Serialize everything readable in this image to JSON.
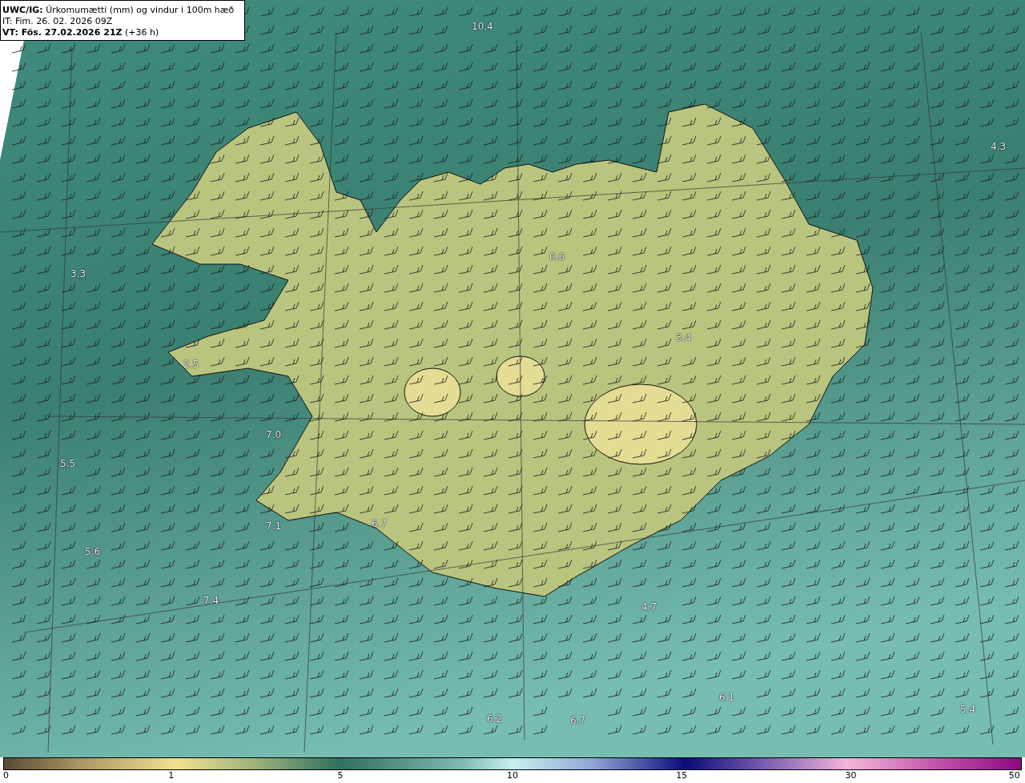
{
  "header": {
    "lines": [
      "**UWC/IG:** Úrkomumætti (mm) og vindur i 100m hæð",
      "IT: Fim. 26. 02. 2026 09Z",
      "**VT: Fös. 27.02.2026 21Z** (+36 h)"
    ]
  },
  "map": {
    "labels": [
      "10.4",
      "4.3",
      "3.3",
      "0.6",
      "3.4",
      "2.5",
      "7.0",
      "5.5",
      "7.1",
      "6.7",
      "5.6",
      "7.4",
      "4.7",
      "6.1",
      "6.2",
      "6.7",
      "5.4"
    ]
  },
  "colorbar": {
    "ticks": [
      "0",
      "1",
      "5",
      "10",
      "15",
      "30",
      "50"
    ]
  }
}
